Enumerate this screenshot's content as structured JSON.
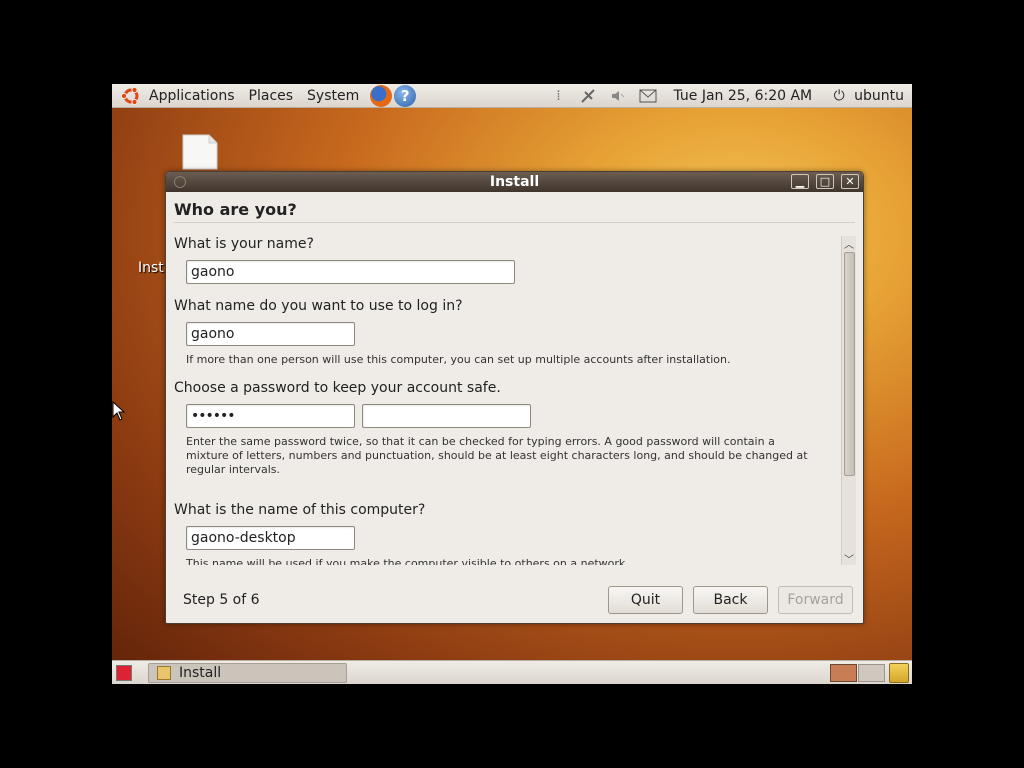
{
  "top_panel": {
    "menus": [
      "Applications",
      "Places",
      "System"
    ],
    "clock": "Tue Jan 25,  6:20 AM",
    "user": "ubuntu"
  },
  "desktop": {
    "icon_label": "Inst"
  },
  "window": {
    "title": "Install",
    "heading": "Who are you?",
    "name_question": "What is your name?",
    "name_value": "gaono",
    "login_question": "What name do you want to use to log in?",
    "login_value": "gaono",
    "login_hint": "If more than one person will use this computer, you can set up multiple accounts after installation.",
    "password_question": "Choose a password to keep your account safe.",
    "password_value": "••••••",
    "password_confirm_value": "",
    "password_hint_1": "Enter the same password twice, so that it can be checked for typing errors. A good password will contain a",
    "password_hint_2": "mixture of letters, numbers and punctuation, should be at least eight characters long, and should be changed at",
    "password_hint_3": "regular intervals.",
    "computer_question": "What is the name of this computer?",
    "computer_value": "gaono-desktop",
    "computer_hint": "This name will be used if you make the computer visible to others on a network.",
    "step": "Step 5 of 6",
    "quit_label": "Quit",
    "back_label": "Back",
    "forward_label": "Forward"
  },
  "bottom_panel": {
    "task_label": "Install"
  },
  "colors": {
    "titlebar": "#4f433a",
    "panel": "#e6e1da",
    "window_bg": "#efebe7"
  }
}
